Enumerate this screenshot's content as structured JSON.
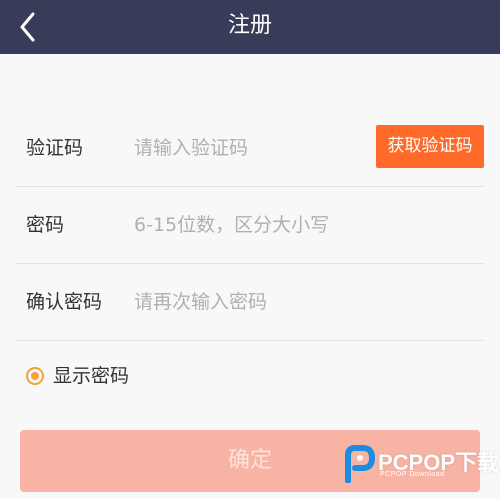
{
  "header": {
    "title": "注册",
    "back_icon": "chevron-left-icon",
    "background": "#383c58"
  },
  "form": {
    "code": {
      "label": "验证码",
      "placeholder": "请输入验证码",
      "button_label": "获取验证码",
      "button_color": "#ff6a2b"
    },
    "password": {
      "label": "密码",
      "placeholder": "6-15位数，区分大小写"
    },
    "confirm_password": {
      "label": "确认密码",
      "placeholder": "请再次输入密码"
    }
  },
  "show_password": {
    "label": "显示密码",
    "checked": true,
    "accent": "#f7a035"
  },
  "confirm_button": {
    "label": "确定",
    "color": "#f7b3a3"
  },
  "watermark": {
    "text": "PCPOP下载",
    "subtext": "PCPOP Download"
  }
}
